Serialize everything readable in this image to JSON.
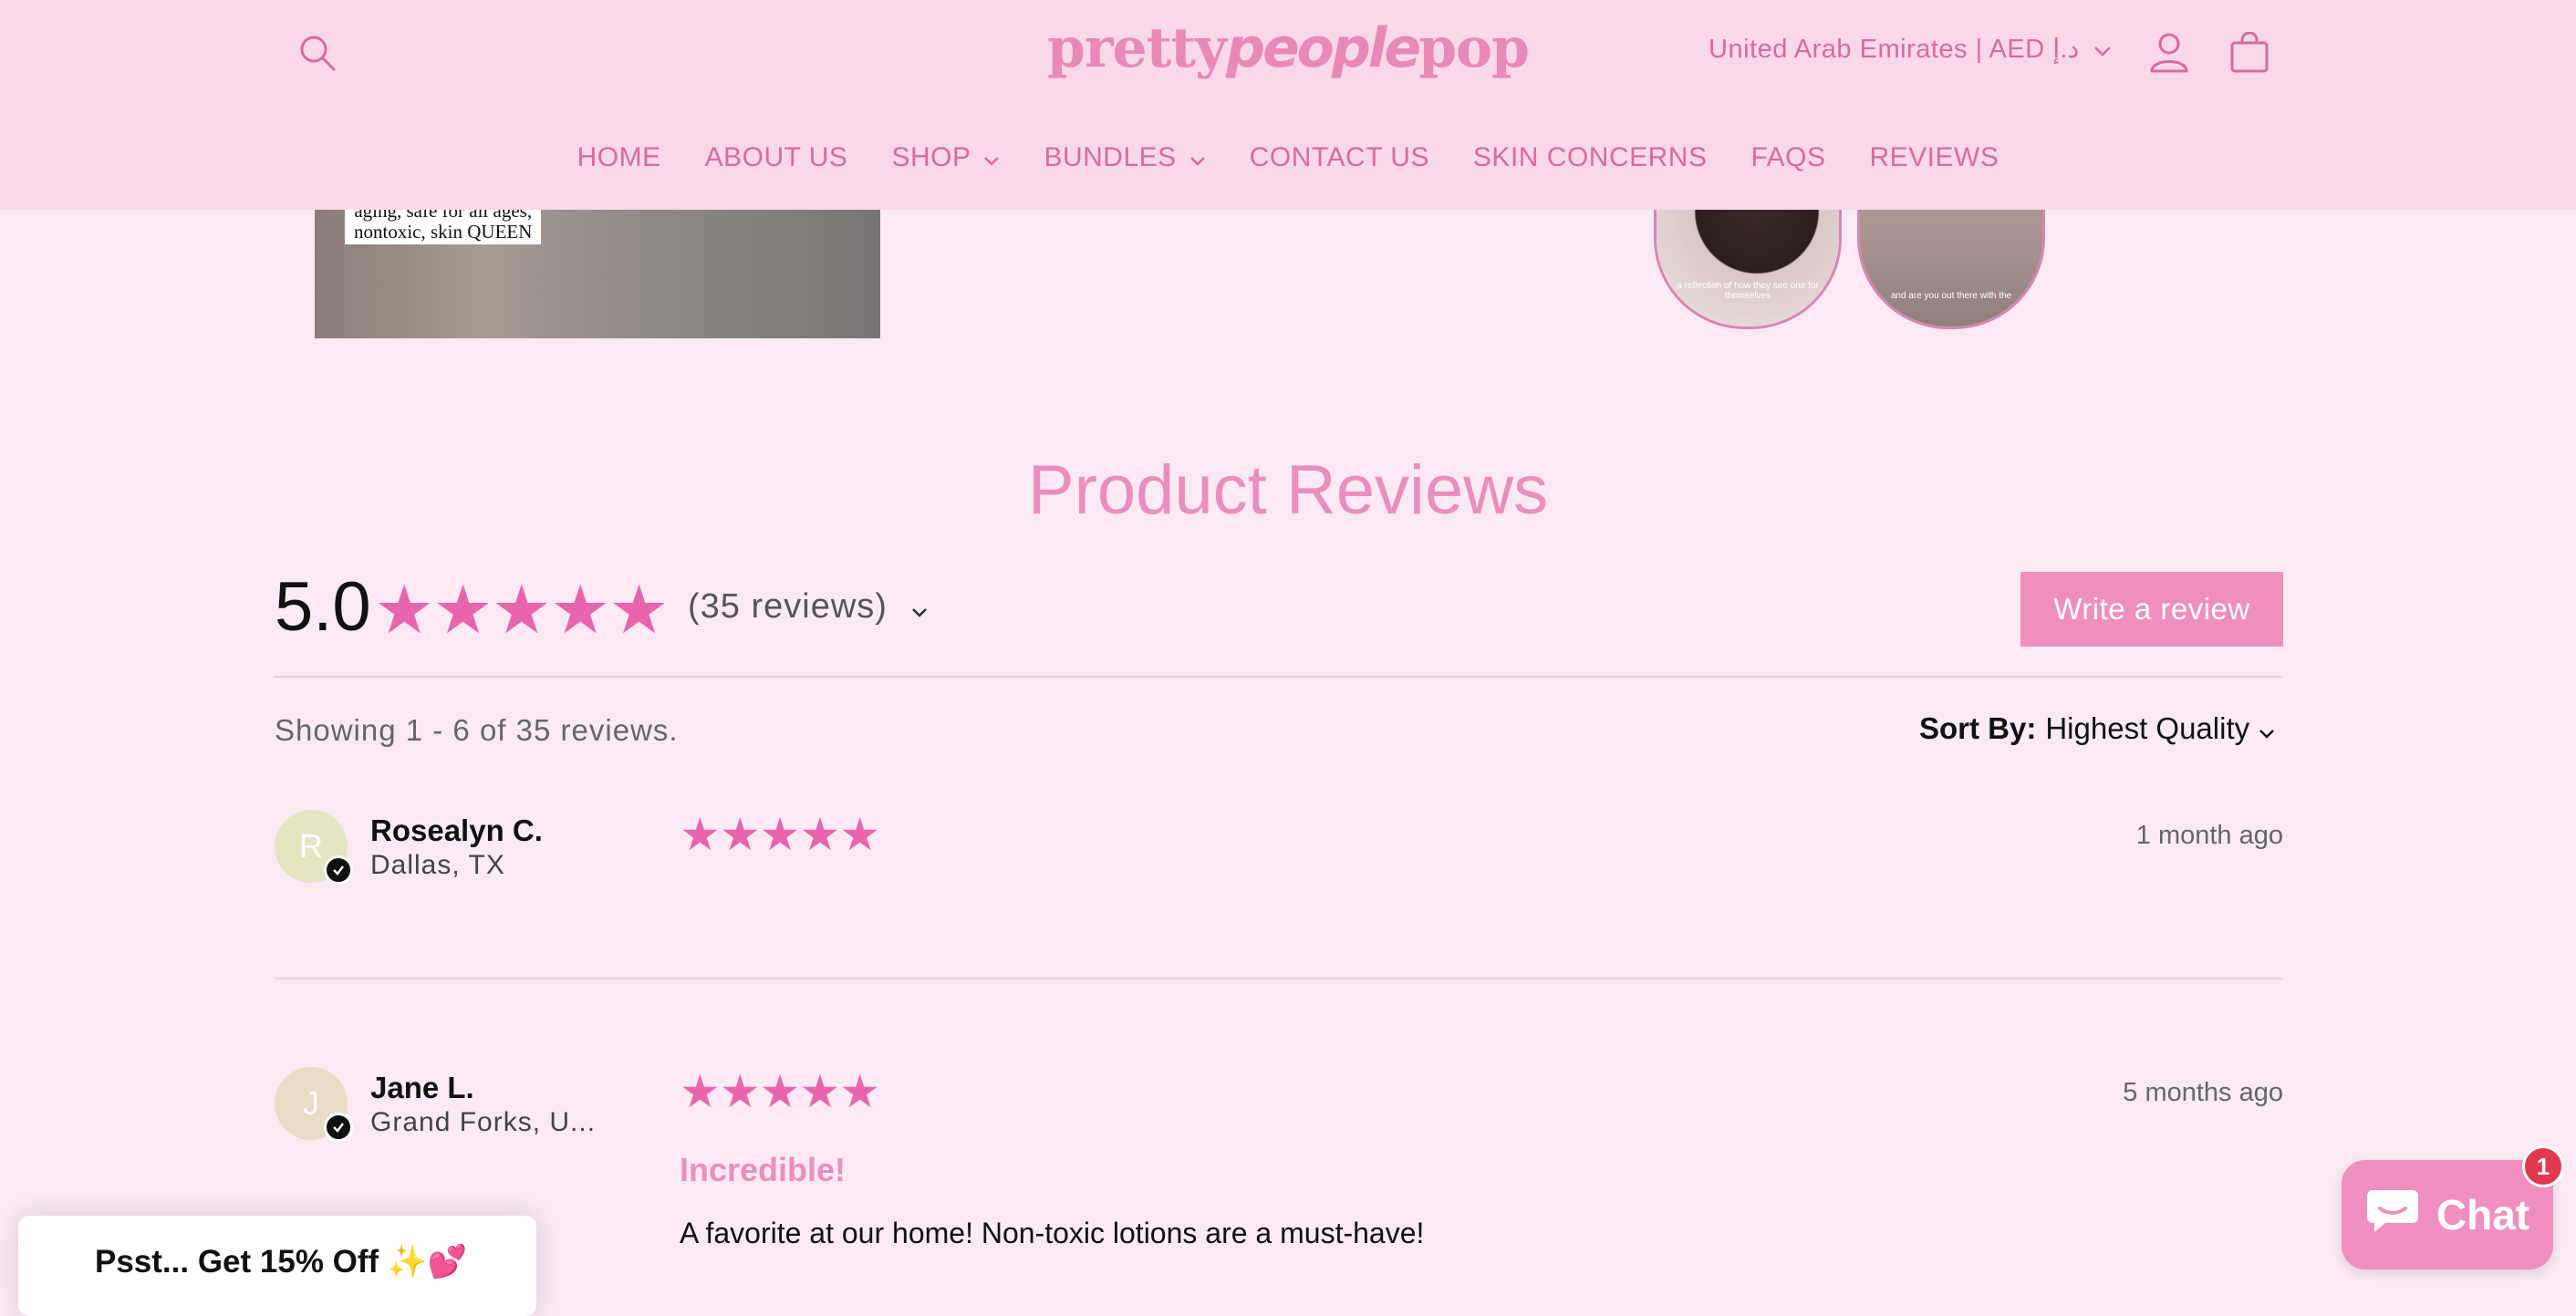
{
  "header": {
    "logo_parts": [
      "pretty",
      "people",
      "pop"
    ],
    "currency_label": "United Arab Emirates | AED د.إ",
    "nav": [
      {
        "label": "HOME",
        "dropdown": false
      },
      {
        "label": "ABOUT US",
        "dropdown": false
      },
      {
        "label": "SHOP",
        "dropdown": true
      },
      {
        "label": "BUNDLES",
        "dropdown": true
      },
      {
        "label": "CONTACT US",
        "dropdown": false
      },
      {
        "label": "SKIN CONCERNS",
        "dropdown": false
      },
      {
        "label": "FAQS",
        "dropdown": false
      },
      {
        "label": "REVIEWS",
        "dropdown": false
      }
    ]
  },
  "media": {
    "video_caption_line1": "aging, safe for all ages,",
    "video_caption_line2": "nontoxic, skin QUEEN",
    "story_captions": [
      "a reflection of how they see one for themselves",
      "and are you out there with the"
    ]
  },
  "reviews": {
    "heading": "Product Reviews",
    "average": "5.0",
    "stars": "★★★★★",
    "count_label": "(35 reviews)",
    "write_button": "Write a review",
    "showing": "Showing 1 - 6 of 35 reviews.",
    "sort_label": "Sort By:",
    "sort_value": "Highest Quality",
    "items": [
      {
        "initial": "R",
        "name": "Rosealyn C.",
        "location": "Dallas, TX",
        "stars": "★★★★★",
        "date": "1 month ago",
        "title": "",
        "body": "",
        "avatar_color": "#e4e6c2"
      },
      {
        "initial": "J",
        "name": "Jane L.",
        "location": "Grand Forks, U...",
        "stars": "★★★★★",
        "date": "5 months ago",
        "title": "Incredible!",
        "body": "A favorite at our home! Non-toxic lotions are a must-have!",
        "avatar_color": "#e8dcc4"
      }
    ]
  },
  "popup": {
    "label": "Psst... Get 15% Off ✨💕"
  },
  "chat": {
    "label": "Chat",
    "badge": "1"
  },
  "colors": {
    "accent": "#e865ae",
    "header_bg": "#f9d8ea",
    "page_bg": "#fbeaf4",
    "button": "#ee8fbe"
  }
}
